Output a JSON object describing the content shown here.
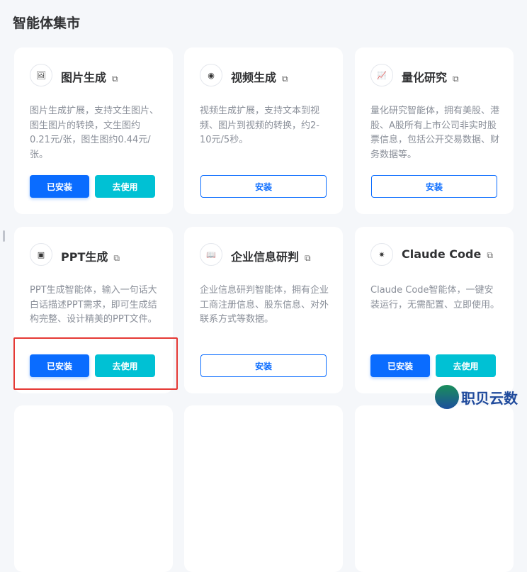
{
  "page_title": "智能体集市",
  "colors": {
    "primary": "#0a6cff",
    "secondary": "#00c1d4",
    "highlight": "#e53935"
  },
  "cards": [
    {
      "name": "图片生成",
      "icon": "image-icon",
      "desc": "图片生成扩展，支持文生图片、图生图片的转换，文生图约0.21元/张，图生图约0.44元/张。",
      "installed": "已安装",
      "use": "去使用"
    },
    {
      "name": "视频生成",
      "icon": "video-icon",
      "desc": "视频生成扩展，支持文本到视频、图片到视频的转换，约2-10元/5秒。",
      "install": "安装"
    },
    {
      "name": "量化研究",
      "icon": "chart-icon",
      "desc": "量化研究智能体，拥有美股、港股、A股所有上市公司非实时股票信息，包括公开交易数据、财务数据等。",
      "install": "安装"
    },
    {
      "name": "PPT生成",
      "icon": "presentation-icon",
      "desc": "PPT生成智能体，输入一句话大白话描述PPT需求，即可生成结构完整、设计精美的PPT文件。",
      "installed": "已安装",
      "use": "去使用"
    },
    {
      "name": "企业信息研判",
      "icon": "book-icon",
      "desc": "企业信息研判智能体，拥有企业工商注册信息、股东信息、对外联系方式等数据。",
      "install": "安装"
    },
    {
      "name": "Claude Code",
      "icon": "asterisk-icon",
      "desc": "Claude Code智能体，一键安装运行，无需配置、立即使用。",
      "installed": "已安装",
      "use": "去使用"
    }
  ],
  "watermark": "职贝云数"
}
